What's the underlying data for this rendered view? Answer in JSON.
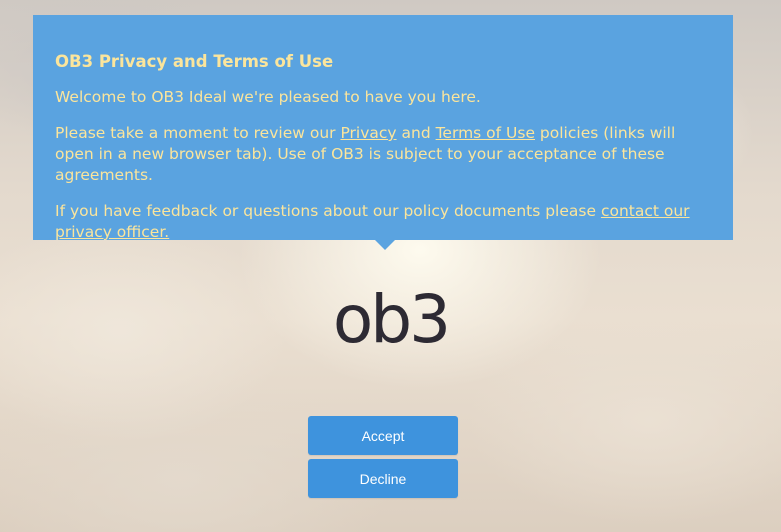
{
  "dialog": {
    "title": "OB3 Privacy and Terms of Use",
    "welcome": "Welcome to OB3 Ideal we're pleased to have you here.",
    "review_text_1": "Please take a moment to review our ",
    "privacy_link": "Privacy",
    "review_text_2": " and ",
    "terms_link": "Terms of Use",
    "review_text_3": " policies (links will open in a new browser tab). Use of OB3 is subject to your acceptance of these agreements.",
    "feedback_text": "If you have feedback or questions about our policy documents please ",
    "contact_link": "contact our privacy officer."
  },
  "logo": {
    "text": "ob3"
  },
  "actions": {
    "accept_label": "Accept",
    "decline_label": "Decline"
  },
  "colors": {
    "dialog_bg": "#5aa3e0",
    "dialog_text": "#fbe59c",
    "button_bg": "#3e93dd",
    "button_text": "#ffffff",
    "logo": "#2d2a33"
  }
}
